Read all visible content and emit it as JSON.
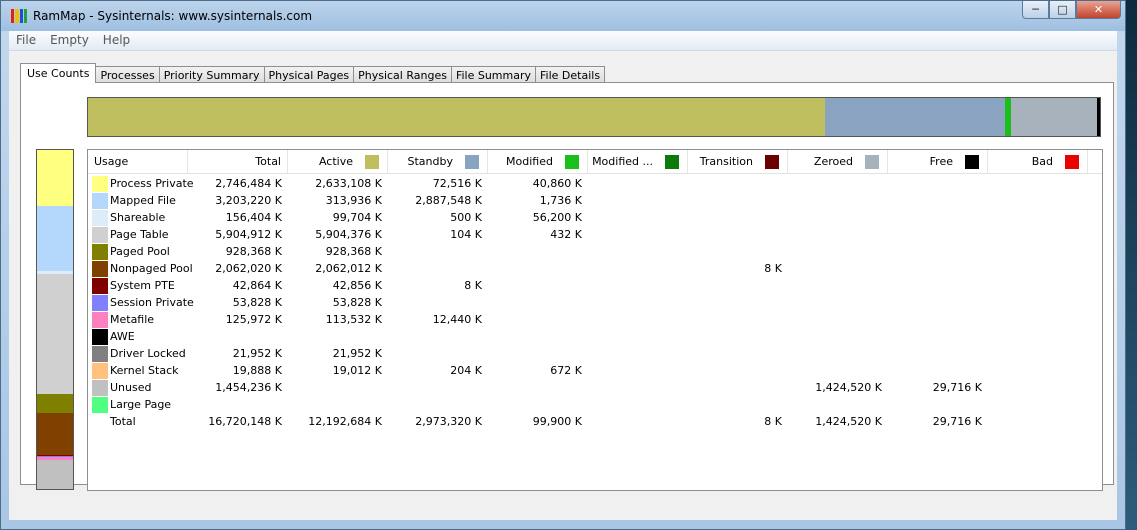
{
  "window": {
    "title": "RamMap - Sysinternals: www.sysinternals.com"
  },
  "menu": [
    "File",
    "Empty",
    "Help"
  ],
  "tabs": [
    "Use Counts",
    "Processes",
    "Priority Summary",
    "Physical Pages",
    "Physical Ranges",
    "File Summary",
    "File Details"
  ],
  "columns": [
    {
      "label": "Usage",
      "color": ""
    },
    {
      "label": "Total",
      "color": ""
    },
    {
      "label": "Active",
      "color": "#bfbf5f"
    },
    {
      "label": "Standby",
      "color": "#8aa3c0"
    },
    {
      "label": "Modified",
      "color": "#1bbf1b"
    },
    {
      "label": "Modified ...",
      "color": "#0a7a0a"
    },
    {
      "label": "Transition",
      "color": "#6b0000"
    },
    {
      "label": "Zeroed",
      "color": "#a8b2bc"
    },
    {
      "label": "Free",
      "color": "#000000"
    },
    {
      "label": "Bad",
      "color": "#ee0000"
    }
  ],
  "rows": [
    {
      "usage": "Process Private",
      "color": "#ffff80",
      "values": [
        "2,746,484 K",
        "2,633,108 K",
        "72,516 K",
        "40,860 K",
        "",
        "",
        "",
        "",
        ""
      ]
    },
    {
      "usage": "Mapped File",
      "color": "#b4d8fc",
      "values": [
        "3,203,220 K",
        "313,936 K",
        "2,887,548 K",
        "1,736 K",
        "",
        "",
        "",
        "",
        ""
      ]
    },
    {
      "usage": "Shareable",
      "color": "#dcecf8",
      "values": [
        "156,404 K",
        "99,704 K",
        "500 K",
        "56,200 K",
        "",
        "",
        "",
        "",
        ""
      ]
    },
    {
      "usage": "Page Table",
      "color": "#d0d0d0",
      "values": [
        "5,904,912 K",
        "5,904,376 K",
        "104 K",
        "432 K",
        "",
        "",
        "",
        "",
        ""
      ]
    },
    {
      "usage": "Paged Pool",
      "color": "#808000",
      "values": [
        "928,368 K",
        "928,368 K",
        "",
        "",
        "",
        "",
        "",
        "",
        ""
      ]
    },
    {
      "usage": "Nonpaged Pool",
      "color": "#804000",
      "values": [
        "2,062,020 K",
        "2,062,012 K",
        "",
        "",
        "",
        "8 K",
        "",
        "",
        ""
      ]
    },
    {
      "usage": "System PTE",
      "color": "#800000",
      "values": [
        "42,864 K",
        "42,856 K",
        "8 K",
        "",
        "",
        "",
        "",
        "",
        ""
      ]
    },
    {
      "usage": "Session Private",
      "color": "#8080ff",
      "values": [
        "53,828 K",
        "53,828 K",
        "",
        "",
        "",
        "",
        "",
        "",
        ""
      ]
    },
    {
      "usage": "Metafile",
      "color": "#ff80c0",
      "values": [
        "125,972 K",
        "113,532 K",
        "12,440 K",
        "",
        "",
        "",
        "",
        "",
        ""
      ]
    },
    {
      "usage": "AWE",
      "color": "#000000",
      "values": [
        "",
        "",
        "",
        "",
        "",
        "",
        "",
        "",
        ""
      ]
    },
    {
      "usage": "Driver Locked",
      "color": "#808080",
      "values": [
        "21,952 K",
        "21,952 K",
        "",
        "",
        "",
        "",
        "",
        "",
        ""
      ]
    },
    {
      "usage": "Kernel Stack",
      "color": "#ffc080",
      "values": [
        "19,888 K",
        "19,012 K",
        "204 K",
        "672 K",
        "",
        "",
        "",
        "",
        ""
      ]
    },
    {
      "usage": "Unused",
      "color": "#c0c0c0",
      "values": [
        "1,454,236 K",
        "",
        "",
        "",
        "",
        "",
        "1,424,520 K",
        "29,716 K",
        ""
      ]
    },
    {
      "usage": "Large Page",
      "color": "#50ff80",
      "values": [
        "",
        "",
        "",
        "",
        "",
        "",
        "",
        "",
        ""
      ]
    },
    {
      "usage": "Total",
      "color": "",
      "values": [
        "16,720,148 K",
        "12,192,684 K",
        "2,973,320 K",
        "99,900 K",
        "",
        "8 K",
        "1,424,520 K",
        "29,716 K",
        ""
      ]
    }
  ],
  "usage_bar": [
    {
      "name": "Process Private",
      "fraction": 0.164,
      "color": "#ffff80"
    },
    {
      "name": "Mapped File",
      "fraction": 0.192,
      "color": "#b4d8fc"
    },
    {
      "name": "Shareable",
      "fraction": 0.009,
      "color": "#dcecf8"
    },
    {
      "name": "Page Table",
      "fraction": 0.353,
      "color": "#d0d0d0"
    },
    {
      "name": "Paged Pool",
      "fraction": 0.056,
      "color": "#808000"
    },
    {
      "name": "Nonpaged Pool",
      "fraction": 0.123,
      "color": "#804000"
    },
    {
      "name": "System PTE",
      "fraction": 0.003,
      "color": "#800000"
    },
    {
      "name": "Session Private",
      "fraction": 0.003,
      "color": "#8080ff"
    },
    {
      "name": "Metafile",
      "fraction": 0.008,
      "color": "#ff80c0"
    },
    {
      "name": "Driver Locked",
      "fraction": 0.001,
      "color": "#808080"
    },
    {
      "name": "Kernel Stack",
      "fraction": 0.001,
      "color": "#ffc080"
    },
    {
      "name": "Unused",
      "fraction": 0.087,
      "color": "#c0c0c0"
    }
  ],
  "state_bar": [
    {
      "name": "Active",
      "fraction": 0.729,
      "color": "#bfbf5f"
    },
    {
      "name": "Standby",
      "fraction": 0.178,
      "color": "#8aa3c0"
    },
    {
      "name": "Modified",
      "fraction": 0.006,
      "color": "#1bbf1b"
    },
    {
      "name": "Zeroed",
      "fraction": 0.085,
      "color": "#a8b2bc"
    },
    {
      "name": "Free",
      "fraction": 0.002,
      "color": "#000000"
    }
  ]
}
